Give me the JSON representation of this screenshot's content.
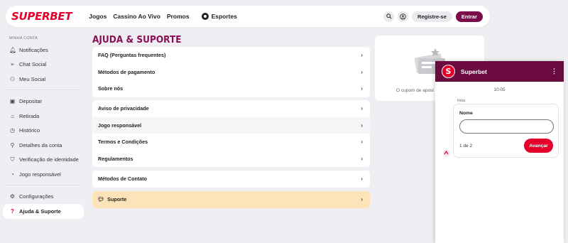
{
  "brand": {
    "logo": "SUPERBET",
    "accent": "#e4002b",
    "primary": "#7a0a4a"
  },
  "nav": {
    "items": [
      "Jogos",
      "Cassino Ao Vivo",
      "Promos"
    ],
    "sports": "Esportes"
  },
  "header": {
    "register": "Registre-se",
    "login": "Entrar"
  },
  "sidebar": {
    "section_title": "MINHA CONTA",
    "group1": [
      {
        "label": "Notificações",
        "icon": "bell-icon"
      },
      {
        "label": "Chat Social",
        "icon": "send-icon"
      },
      {
        "label": "Meu Social",
        "icon": "people-icon"
      }
    ],
    "group2": [
      {
        "label": "Depositar",
        "icon": "wallet-icon"
      },
      {
        "label": "Retirada",
        "icon": "bank-icon"
      },
      {
        "label": "Histórico",
        "icon": "history-icon"
      },
      {
        "label": "Detalhes da conta",
        "icon": "user-icon"
      },
      {
        "label": "Verificação de identidade",
        "icon": "shield-check-icon"
      },
      {
        "label": "Jogo responsável",
        "icon": "gauge-icon"
      }
    ],
    "group3": [
      {
        "label": "Configurações",
        "icon": "gear-icon"
      },
      {
        "label": "Ajuda & Suporte",
        "icon": "help-icon"
      }
    ]
  },
  "main": {
    "title": "AJUDA & SUPORTE",
    "group1": [
      "FAQ (Perguntas frequentes)",
      "Métodos de pagamento",
      "Sobre nós"
    ],
    "group2": [
      "Aviso de privacidade",
      "Jogo responsável",
      "Termos e Condições",
      "Regulamentos"
    ],
    "group3": [
      "Métodos de Contato"
    ],
    "support": "Suporte"
  },
  "coupon": {
    "empty_text": "O cupom de apost"
  },
  "chat": {
    "title": "Superbet",
    "logo_letter": "S",
    "time": "10:05",
    "agent": "Irina",
    "field_label": "Nome",
    "field_value": "",
    "step": "1 de 2",
    "next": "Avançar"
  }
}
